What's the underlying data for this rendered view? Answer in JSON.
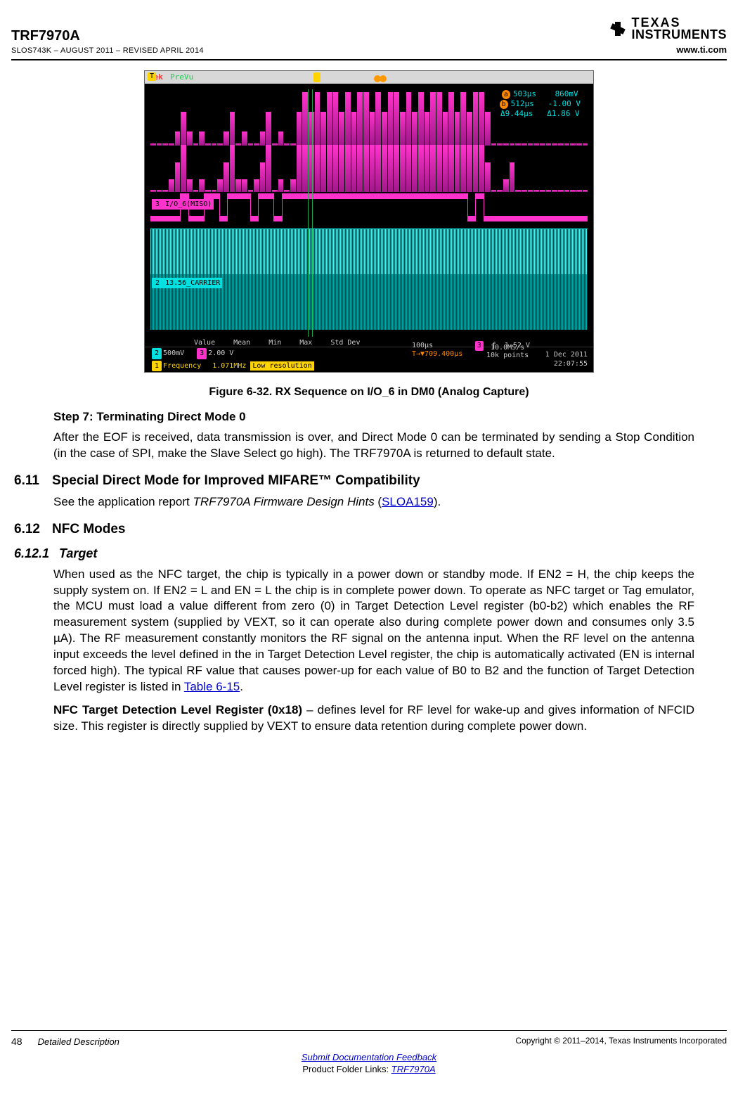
{
  "header": {
    "product": "TRF7970A",
    "docref": "SLOS743K – AUGUST 2011 – REVISED APRIL 2014",
    "url": "www.ti.com",
    "logo_line1": "TEXAS",
    "logo_line2": "INSTRUMENTS"
  },
  "figure": {
    "caption": "Figure 6-32. RX Sequence on I/O_6 in DM0 (Analog Capture)",
    "scope": {
      "brand": "Tek",
      "mode": "PreVu",
      "trig_symbol": "T",
      "readout": {
        "a_time": "503µs",
        "a_volt": "860mV",
        "b_time": "512µs",
        "b_volt": "-1.00 V",
        "d_time": "Δ9.44µs",
        "d_volt": "Δ1.86 V"
      },
      "ch3_label": "I/O_6(MISO)",
      "ch2_label": "13.56_CARRIER",
      "bottom": {
        "headers": [
          "Value",
          "Mean",
          "Min",
          "Max",
          "Std Dev"
        ],
        "ch2_scale": "500mV",
        "ch3_scale": "2.00 V",
        "ch1_name": "Frequency",
        "ch1_val": "1.071MHz",
        "ch1_note": "Low resolution",
        "timebase": "100µs",
        "trig_delay": "T→▼709.400µs",
        "rate": "10.0MS/s",
        "points": "10k points",
        "trig_ch": "3",
        "trig_edge": "1.52 V",
        "date": "1 Dec 2011",
        "time": "22:07:55"
      }
    }
  },
  "body": {
    "step7_head": "Step 7: Terminating Direct Mode 0",
    "step7_p": "After the EOF is received, data transmission is over, and Direct Mode 0 can be terminated by sending a Stop Condition (in the case of SPI, make the Slave Select go high). The TRF7970A is returned to default state.",
    "sec611_num": "6.11",
    "sec611_title": "Special Direct Mode for Improved MIFARE™ Compatibility",
    "sec611_p_pre": "See the application report ",
    "sec611_p_em": "TRF7970A Firmware Design Hints",
    "sec611_p_mid": " (",
    "sec611_p_link": "SLOA159",
    "sec611_p_post": ").",
    "sec612_num": "6.12",
    "sec612_title": "NFC Modes",
    "sec6121_num": "6.12.1",
    "sec6121_title": "Target",
    "sec6121_p1": "When used as the NFC target, the chip is typically in a power down or standby mode. If EN2 = H, the chip keeps the supply system on. If EN2 = L and EN = L the chip is in complete power down. To operate as NFC target or Tag emulator, the MCU must load a value different from zero (0) in Target Detection Level register (b0-b2) which enables the RF measurement system (supplied by VEXT, so it can operate also during complete power down and consumes only 3.5 µA). The RF measurement constantly monitors the RF signal on the antenna input. When the RF level on the antenna input exceeds the level defined in the in Target Detection Level register, the chip is automatically activated (EN is internal forced high). The typical RF value that causes power-up for each value of B0 to B2 and the function of Target Detection Level register is listed in ",
    "sec6121_tableref": "Table 6-15",
    "sec6121_p1_end": ".",
    "sec6121_p2_strong": "NFC Target Detection Level Register (0x18)",
    "sec6121_p2_rest": " – defines level for RF level for wake-up and gives information of NFCID size. This register is directly supplied by VEXT to ensure data retention during complete power down."
  },
  "footer": {
    "page": "48",
    "section": "Detailed Description",
    "copyright": "Copyright © 2011–2014, Texas Instruments Incorporated",
    "feedback": "Submit Documentation Feedback",
    "links_prefix": "Product Folder Links: ",
    "links_product": "TRF7970A"
  }
}
